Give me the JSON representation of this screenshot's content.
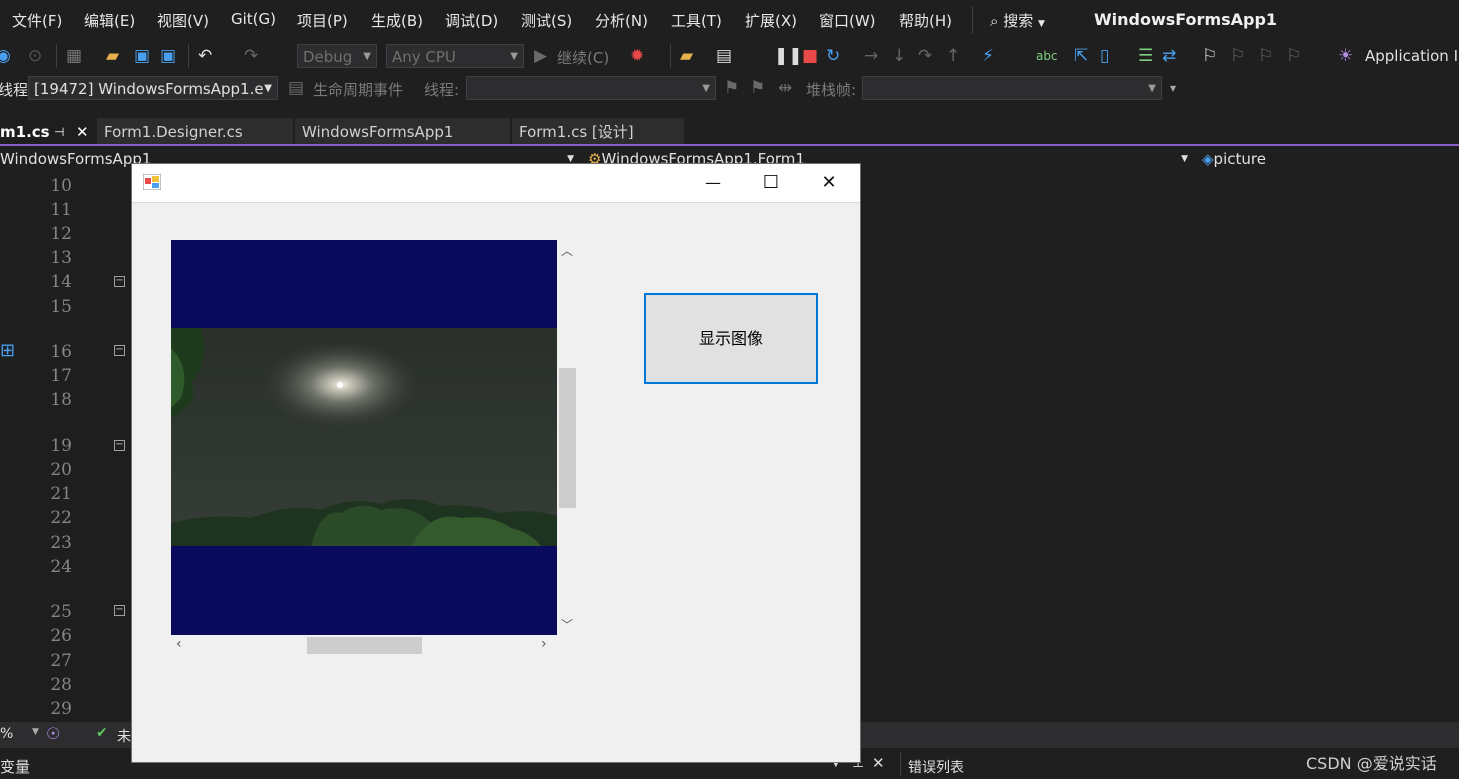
{
  "menu": {
    "items": [
      "文件(F)",
      "编辑(E)",
      "视图(V)",
      "Git(G)",
      "项目(P)",
      "生成(B)",
      "调试(D)",
      "测试(S)",
      "分析(N)",
      "工具(T)",
      "扩展(X)",
      "窗口(W)",
      "帮助(H)"
    ],
    "search_label": "搜索",
    "app_title": "WindowsFormsApp1"
  },
  "toolbar": {
    "config": "Debug",
    "platform": "Any CPU",
    "continue_label": "继续(C)",
    "app_insights": "Application In"
  },
  "debug_toolbar": {
    "process_label": "线程:",
    "process_value": "[19472] WindowsFormsApp1.e",
    "lifecycle_label": "生命周期事件",
    "thread_label": "线程:",
    "stackframe_label": "堆栈帧:"
  },
  "tabs": [
    {
      "label": "m1.cs",
      "active": true
    },
    {
      "label": "Form1.Designer.cs"
    },
    {
      "label": "WindowsFormsApp1"
    },
    {
      "label": "Form1.cs [设计]"
    }
  ],
  "navbar": {
    "project": "WindowsFormsApp1",
    "class": "WindowsFormsApp1.Form1",
    "member": "picture"
  },
  "editor": {
    "line_numbers": [
      "10",
      "11",
      "12",
      "13",
      "14",
      "15",
      "16",
      "17",
      "18",
      "19",
      "20",
      "21",
      "22",
      "23",
      "24",
      "25",
      "26",
      "27",
      "28",
      "29"
    ]
  },
  "status": {
    "zoom": "%",
    "issues_text": "未"
  },
  "bottom_panels": {
    "left": "变量",
    "right": "错误列表"
  },
  "form": {
    "show_button_label": "显示图像"
  },
  "watermark": "CSDN @爱说实话",
  "colors": {
    "accent": "#8660c5",
    "picture_background": "#0a0a5e",
    "button_focus": "#0078d7"
  }
}
